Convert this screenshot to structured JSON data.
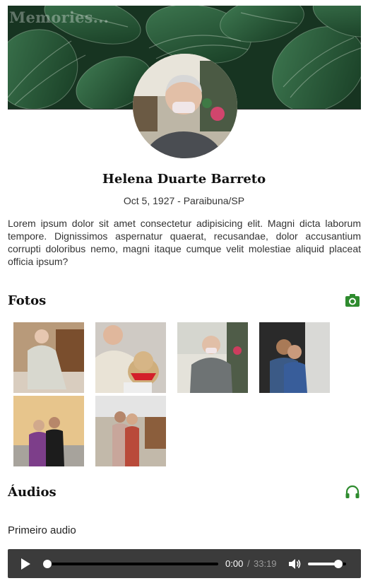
{
  "site": {
    "title": "Memories..."
  },
  "profile": {
    "name": "Helena Duarte Barreto",
    "dates": "Oct 5, 1927 - Paraibuna/SP",
    "bio": "Lorem ipsum dolor sit amet consectetur adipisicing elit. Magni dicta laborum tempore. Dignissimos aspernatur quaerat, recusandae, dolor accusantium corrupti doloribus nemo, magni itaque cumque velit molestiae aliquid placeat officia ipsum?"
  },
  "photos": {
    "title": "Fotos",
    "icon": "camera-icon",
    "count": 6
  },
  "audios": {
    "title": "Áudios",
    "icon": "headphones-icon",
    "items": [
      {
        "title": "Primeiro audio",
        "current_time": "0:00",
        "separator": "/",
        "duration": "33:19",
        "progress": 0.0,
        "volume": 0.8
      }
    ]
  },
  "colors": {
    "accent": "#2e8b2e",
    "player_bg": "#3b3b3b"
  }
}
